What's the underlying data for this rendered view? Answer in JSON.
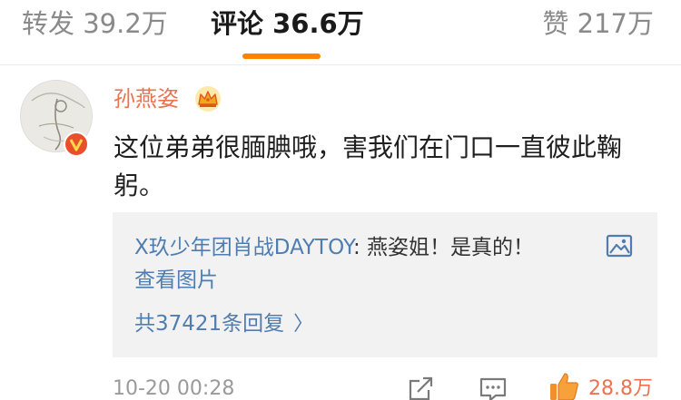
{
  "tabs": {
    "repost": "转发 39.2万",
    "comment": "评论 36.6万",
    "like": "赞 217万",
    "active": "comment",
    "accent_color": "#ff8200"
  },
  "comment": {
    "username": "孙燕姿",
    "username_color": "#eb7350",
    "user_badge_icon": "crown-icon",
    "verified_icon": "verified-v-icon",
    "text": "这位弟弟很腼腆哦，害我们在门口一直彼此鞠躬。",
    "reply_preview": {
      "author": "X玖少年团肖战DAYTOY",
      "content": ": 燕姿姐！是真的！",
      "image_icon": "image-icon",
      "view_image_label": "查看图片",
      "reply_count_label": "共37421条回复",
      "link_color": "#507daf"
    },
    "timestamp": "10-20 00:28",
    "like_count": "28.8万"
  }
}
